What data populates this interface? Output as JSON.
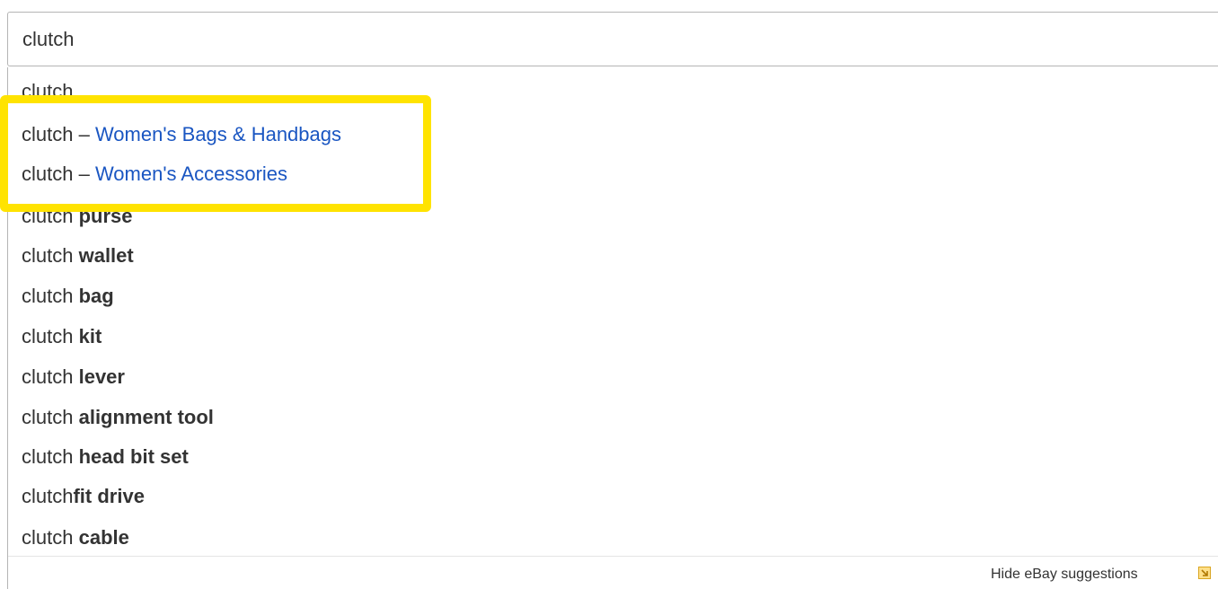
{
  "search": {
    "value": "clutch"
  },
  "suggestions": [
    {
      "prefix": "clutch",
      "bold": ""
    },
    {
      "prefix": "clutch – ",
      "category": "Women's Bags & Handbags"
    },
    {
      "prefix": "clutch – ",
      "category": "Women's Accessories"
    },
    {
      "prefix": "clutch ",
      "bold": "purse"
    },
    {
      "prefix": "clutch ",
      "bold": "wallet"
    },
    {
      "prefix": "clutch ",
      "bold": "bag"
    },
    {
      "prefix": "clutch ",
      "bold": "kit"
    },
    {
      "prefix": "clutch ",
      "bold": "lever"
    },
    {
      "prefix": "clutch ",
      "bold": "alignment tool"
    },
    {
      "prefix": "clutch ",
      "bold": "head bit set"
    },
    {
      "prefix": "clutch",
      "bold": "fit drive"
    },
    {
      "prefix": "clutch ",
      "bold": "cable"
    }
  ],
  "footer": {
    "hide_label": "Hide eBay suggestions",
    "icon": "expand-arrow-icon"
  },
  "colors": {
    "highlight": "#ffe300",
    "category_link": "#1a56c2",
    "border": "#b5b5b5"
  }
}
